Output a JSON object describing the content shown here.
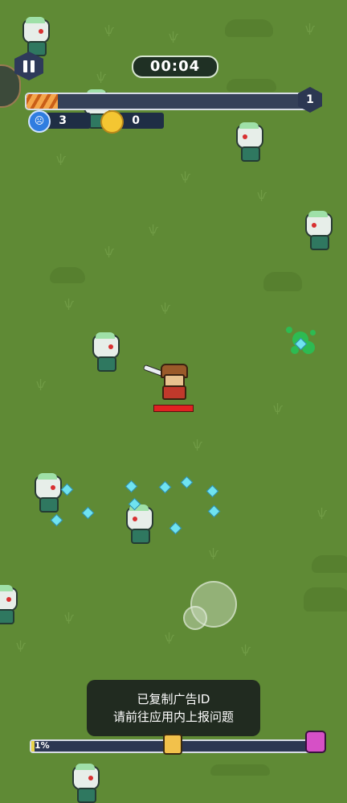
{
  "hud": {
    "timer": "00:04",
    "level": "1",
    "xp_progress": 0.11,
    "kill_count": "3",
    "coin_count": "0"
  },
  "toast": {
    "line1": "已复制广告ID",
    "line2": "请前往应用内上报问题"
  },
  "wave_progress": {
    "percent_label": "1%",
    "value": 0.01
  },
  "colors": {
    "grass": "#5f8a35",
    "xp_fill": "#f5a64a",
    "hp": "#e02222",
    "gem": "#6fe3f0",
    "splat": "#2dbb52"
  },
  "icons": {
    "pause": "pause-icon",
    "kills": "skull-icon",
    "coins": "coin-icon",
    "mid_boss": "miniboss-icon",
    "boss": "boss-demon-icon"
  }
}
